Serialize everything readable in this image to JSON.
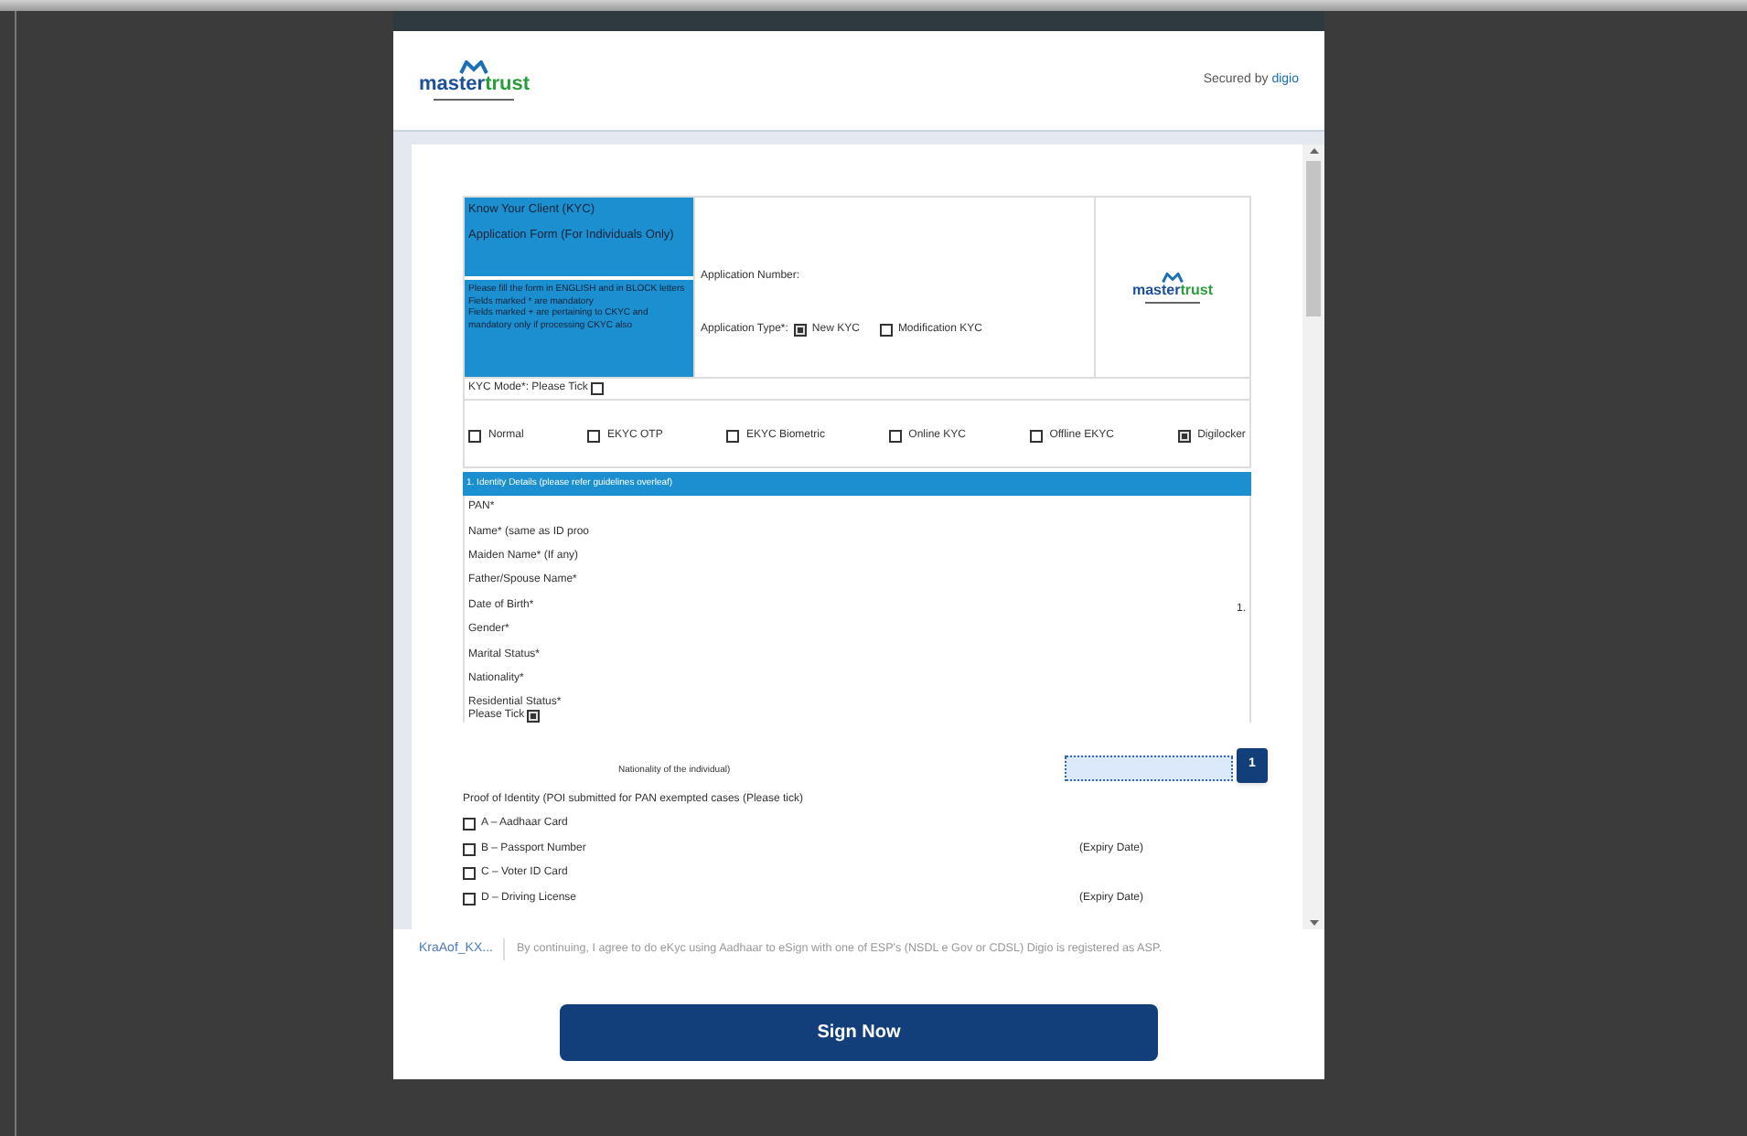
{
  "header": {
    "logo_text_1": "master",
    "logo_text_2": "trust",
    "secured_by": "Secured by",
    "secured_brand": "digio"
  },
  "form_logo": {
    "logo_text_1": "master",
    "logo_text_2": "trust"
  },
  "form": {
    "title_lines": [
      "Know Your Client (KYC)",
      "Application Form (For Individuals Only)"
    ],
    "instructions": [
      "Please fill the form in ENGLISH and in BLOCK letters",
      "Fields marked * are mandatory",
      "Fields marked + are pertaining to CKYC and mandatory only if processing CKYC also"
    ],
    "application_number": "Application Number:",
    "application_type": "Application Type*:",
    "application_types": [
      {
        "label": "New KYC",
        "checked": true
      },
      {
        "label": "Modification KYC",
        "checked": false
      }
    ],
    "kyc_mode": "KYC Mode*: Please Tick",
    "kyc_mode_checked": false,
    "modes": [
      {
        "label": "Normal",
        "checked": false
      },
      {
        "label": "EKYC OTP",
        "checked": false
      },
      {
        "label": "EKYC Biometric",
        "checked": false
      },
      {
        "label": "Online KYC",
        "checked": false
      },
      {
        "label": "Offline EKYC",
        "checked": false
      },
      {
        "label": "Digilocker",
        "checked": true
      }
    ],
    "section_title": "1. Identity Details (please refer guidelines overleaf)",
    "fields": [
      "PAN*",
      "Name* (same as ID proo",
      "Maiden Name* (If any)",
      "Father/Spouse Name*",
      "Date of Birth*",
      "Gender*",
      "Marital Status*",
      "Nationality*"
    ],
    "residential_status": "Residential Status*",
    "please_tick": "Please Tick",
    "please_tick_checked": true,
    "side_mark": "1.",
    "nationality_note": "Nationality of the individual)",
    "proof_title": "Proof of Identity (POI submitted for PAN exempted cases (Please tick)",
    "proofs": [
      {
        "label": "A – Aadhaar Card",
        "checked": false
      },
      {
        "label": "B – Passport Number",
        "checked": false,
        "note": "(Expiry Date)"
      },
      {
        "label": "C – Voter ID Card",
        "checked": false
      },
      {
        "label": "D – Driving License",
        "checked": false,
        "note": "(Expiry Date)"
      }
    ]
  },
  "page_badge": "1",
  "footer": {
    "file_link": "KraAof_KX...",
    "disclaimer": "By continuing, I agree to do eKyc using Aadhaar to eSign with one of ESP's (NSDL e Gov or CDSL) Digio is registered as ASP.",
    "button": "Sign Now"
  }
}
